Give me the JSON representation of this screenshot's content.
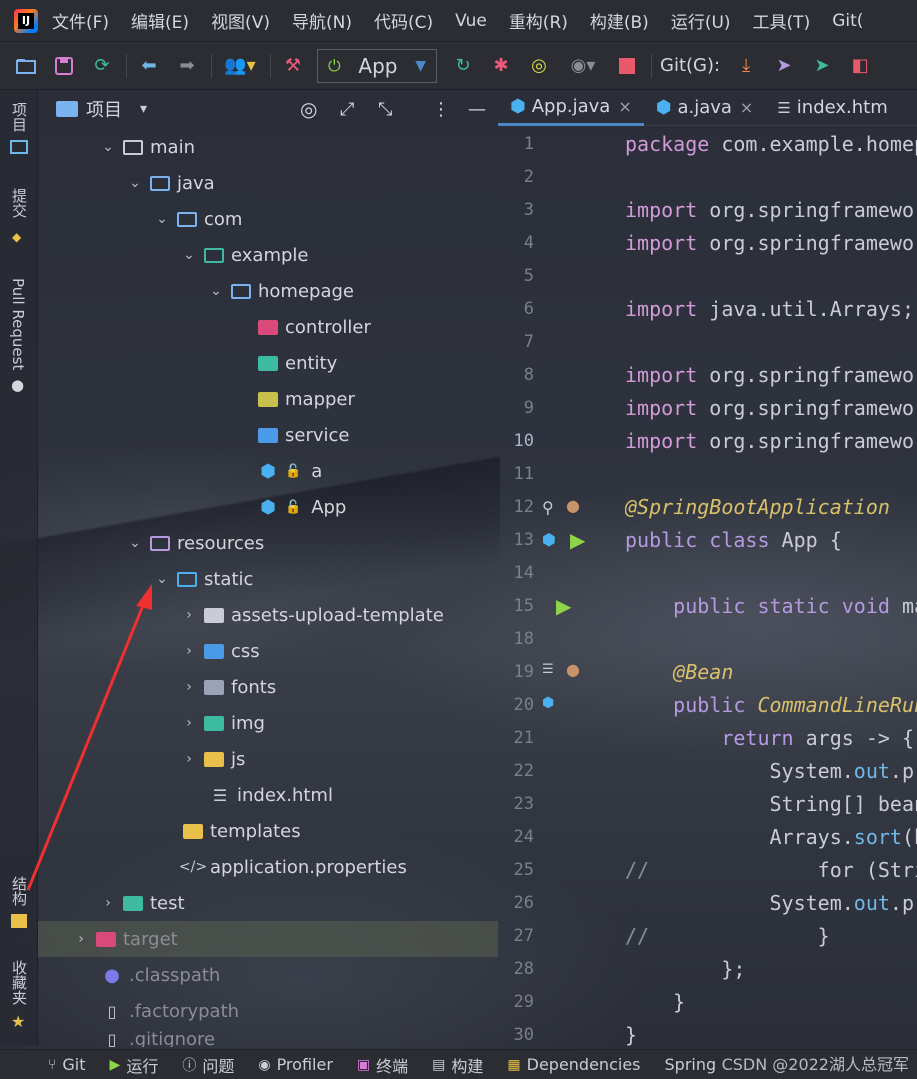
{
  "menubar": {
    "items": [
      "文件(F)",
      "编辑(E)",
      "视图(V)",
      "导航(N)",
      "代码(C)",
      "Vue",
      "重构(R)",
      "构建(B)",
      "运行(U)",
      "工具(T)",
      "Git("
    ]
  },
  "toolbar": {
    "run_config": "App",
    "git_label": "Git(G):"
  },
  "leftstrip": {
    "project": "项目",
    "commit": "提交",
    "pull_request": "Pull Request",
    "structure": "结构",
    "favorites": "收藏夹"
  },
  "panel": {
    "title": "项目"
  },
  "tree": [
    {
      "label": "main",
      "chevron": "v",
      "indent": 0
    },
    {
      "label": "java",
      "chevron": "v",
      "indent": 1
    },
    {
      "label": "com",
      "chevron": "v",
      "indent": 2
    },
    {
      "label": "example",
      "chevron": "v",
      "indent": 3
    },
    {
      "label": "homepage",
      "chevron": "v",
      "indent": 4
    },
    {
      "label": "controller",
      "chevron": "",
      "indent": 5
    },
    {
      "label": "entity",
      "chevron": "",
      "indent": 5
    },
    {
      "label": "mapper",
      "chevron": "",
      "indent": 5
    },
    {
      "label": "service",
      "chevron": "",
      "indent": 5
    },
    {
      "label": "a",
      "chevron": "",
      "indent": 5
    },
    {
      "label": "App",
      "chevron": "",
      "indent": 5
    },
    {
      "label": "resources",
      "chevron": "v",
      "indent": 1
    },
    {
      "label": "static",
      "chevron": "v",
      "indent": 2
    },
    {
      "label": "assets-upload-template",
      "chevron": ">",
      "indent": 3
    },
    {
      "label": "css",
      "chevron": ">",
      "indent": 3
    },
    {
      "label": "fonts",
      "chevron": ">",
      "indent": 3
    },
    {
      "label": "img",
      "chevron": ">",
      "indent": 3
    },
    {
      "label": "js",
      "chevron": ">",
      "indent": 3
    },
    {
      "label": "index.html",
      "chevron": "",
      "indent": 3
    },
    {
      "label": "templates",
      "chevron": "",
      "indent": 2
    },
    {
      "label": "application.properties",
      "chevron": "",
      "indent": 2
    },
    {
      "label": "test",
      "chevron": ">",
      "indent": 0
    },
    {
      "label": "target",
      "chevron": ">",
      "indent": -1
    },
    {
      "label": ".classpath",
      "chevron": "",
      "indent": -1
    },
    {
      "label": ".factorypath",
      "chevron": "",
      "indent": -1
    },
    {
      "label": ".gitignore",
      "chevron": "",
      "indent": -1
    }
  ],
  "tabs": [
    {
      "label": "App.java",
      "close": "×"
    },
    {
      "label": "a.java",
      "close": "×"
    },
    {
      "label": "index.htm",
      "close": ""
    }
  ],
  "editor": {
    "line_numbers": [
      "1",
      "2",
      "3",
      "4",
      "5",
      "6",
      "7",
      "8",
      "9",
      "10",
      "11",
      "12",
      "13",
      "14",
      "15",
      "18",
      "19",
      "20",
      "21",
      "22",
      "23",
      "24",
      "25",
      "26",
      "27",
      "28",
      "29",
      "30"
    ],
    "current_line": "10"
  },
  "statusbar": {
    "items": [
      "Git",
      "运行",
      "问题",
      "Profiler",
      "终端",
      "构建",
      "Dependencies",
      "Spring"
    ]
  },
  "watermark": "CSDN @2022湖人总冠军"
}
